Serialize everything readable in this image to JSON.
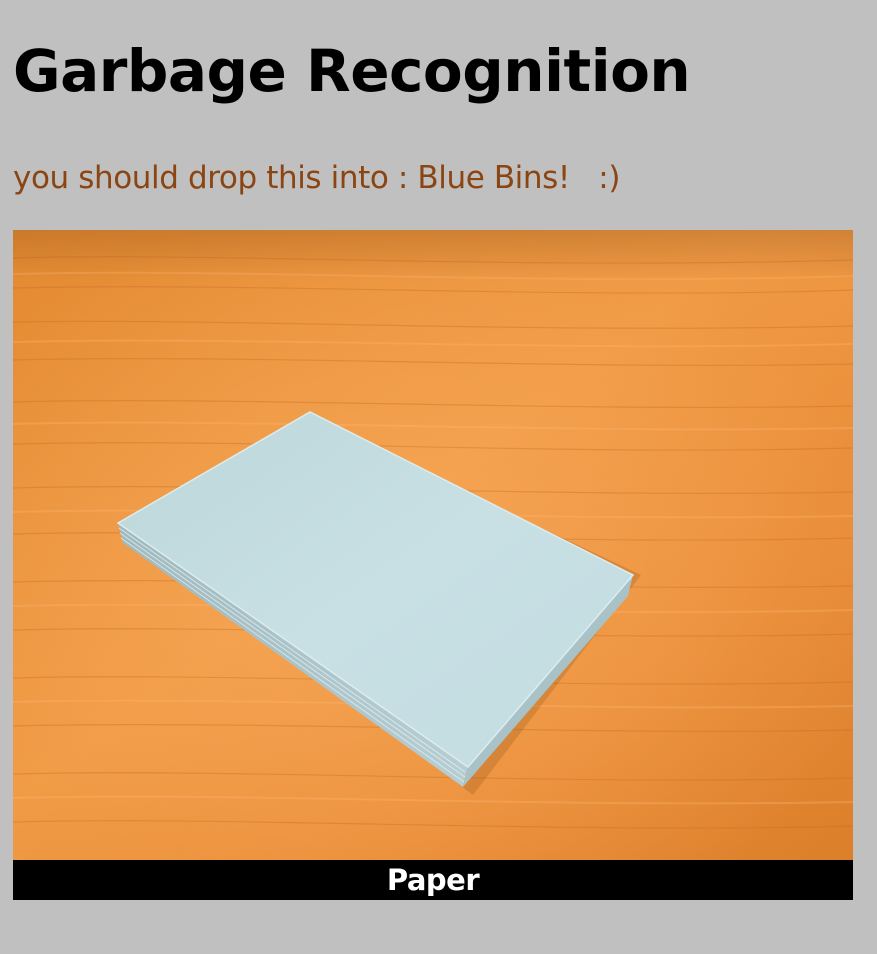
{
  "header": {
    "title": "Garbage Recognition"
  },
  "result": {
    "message": "you should drop this into : Blue Bins!   :)",
    "label": "Paper"
  },
  "colors": {
    "background": "#c0c0c0",
    "message": "#8b4513",
    "caption_bg": "#000000",
    "caption_text": "#ffffff"
  }
}
